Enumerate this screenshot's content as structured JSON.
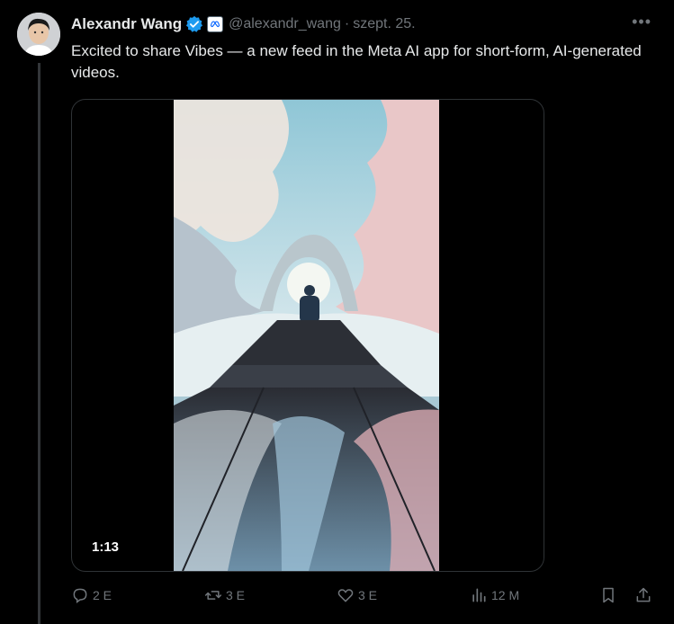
{
  "tweet": {
    "author_name": "Alexandr Wang",
    "handle": "@alexandr_wang",
    "separator": "·",
    "date": "szept. 25.",
    "text": "Excited to share Vibes — a new feed in the Meta AI app for short-form, AI-generated videos.",
    "video_duration": "1:13",
    "more_icon": "more-icon"
  },
  "actions": {
    "replies": "2 E",
    "reposts": "3 E",
    "likes": "3 E",
    "views": "12 M"
  },
  "colors": {
    "background": "#000000",
    "text": "#e7e9ea",
    "muted": "#71767b",
    "verified_blue": "#1d9bf0",
    "border": "#2f3336"
  }
}
